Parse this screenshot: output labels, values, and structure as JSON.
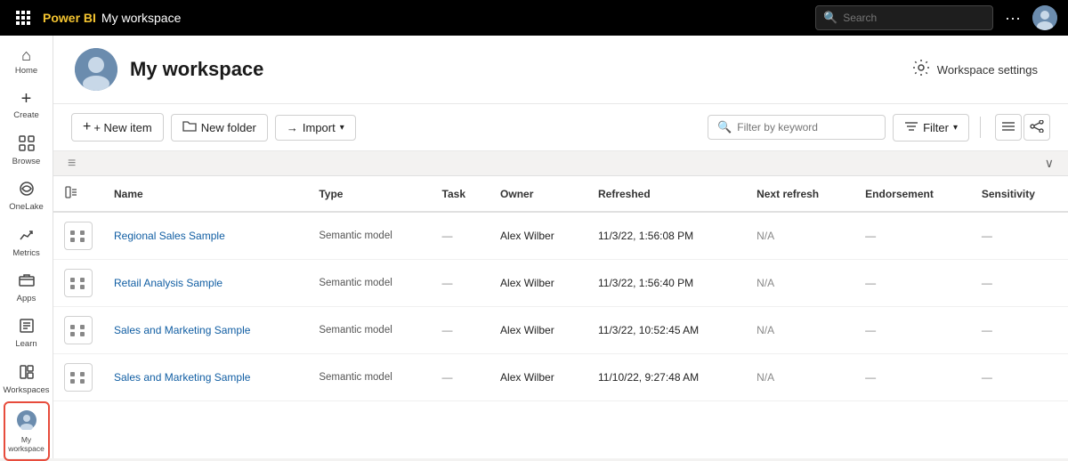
{
  "topbar": {
    "brand": "Power BI",
    "workspace_name": "My workspace",
    "search_placeholder": "Search",
    "more_label": "···"
  },
  "sidebar": {
    "items": [
      {
        "id": "home",
        "label": "Home",
        "icon": "⌂"
      },
      {
        "id": "create",
        "label": "Create",
        "icon": "+"
      },
      {
        "id": "browse",
        "label": "Browse",
        "icon": "⊞"
      },
      {
        "id": "onelake",
        "label": "OneLake",
        "icon": "◈"
      },
      {
        "id": "metrics",
        "label": "Metrics",
        "icon": "⚑"
      },
      {
        "id": "apps",
        "label": "Apps",
        "icon": "⊟"
      },
      {
        "id": "learn",
        "label": "Learn",
        "icon": "□"
      },
      {
        "id": "workspaces",
        "label": "Workspaces",
        "icon": "⊕"
      },
      {
        "id": "myworkspace",
        "label": "My workspace",
        "icon": "👤",
        "active": true,
        "highlighted": true
      }
    ]
  },
  "workspace": {
    "title": "My workspace",
    "settings_label": "Workspace settings"
  },
  "toolbar": {
    "new_item_label": "+ New item",
    "new_folder_label": "New folder",
    "import_label": "Import",
    "filter_keyword_placeholder": "Filter by keyword",
    "filter_label": "Filter",
    "view_list_icon": "≡",
    "view_share_icon": "⋈"
  },
  "table": {
    "columns": [
      "",
      "Name",
      "Type",
      "Task",
      "Owner",
      "Refreshed",
      "Next refresh",
      "Endorsement",
      "Sensitivity"
    ],
    "rows": [
      {
        "name": "Regional Sales Sample",
        "type": "Semantic model",
        "task": "—",
        "owner": "Alex Wilber",
        "refreshed": "11/3/22, 1:56:08 PM",
        "next_refresh": "N/A",
        "endorsement": "—",
        "sensitivity": "—"
      },
      {
        "name": "Retail Analysis Sample",
        "type": "Semantic model",
        "task": "—",
        "owner": "Alex Wilber",
        "refreshed": "11/3/22, 1:56:40 PM",
        "next_refresh": "N/A",
        "endorsement": "—",
        "sensitivity": "—"
      },
      {
        "name": "Sales and Marketing Sample",
        "type": "Semantic model",
        "task": "—",
        "owner": "Alex Wilber",
        "refreshed": "11/3/22, 10:52:45 AM",
        "next_refresh": "N/A",
        "endorsement": "—",
        "sensitivity": "—"
      },
      {
        "name": "Sales and Marketing Sample",
        "type": "Semantic model",
        "task": "—",
        "owner": "Alex Wilber",
        "refreshed": "11/10/22, 9:27:48 AM",
        "next_refresh": "N/A",
        "endorsement": "—",
        "sensitivity": "—"
      }
    ]
  }
}
